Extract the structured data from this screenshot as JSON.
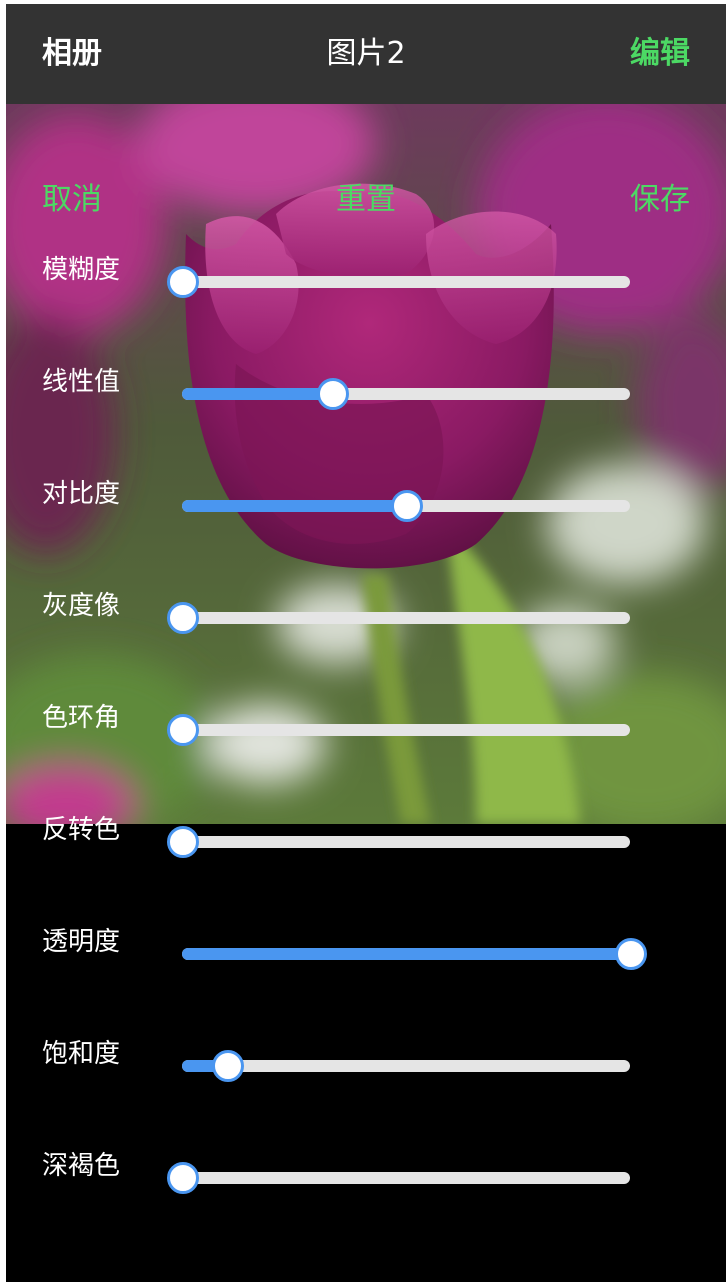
{
  "navbar": {
    "back_label": "相册",
    "title": "图片2",
    "edit_label": "编辑"
  },
  "photo": {
    "subject": "purple tulips"
  },
  "actions": {
    "cancel_label": "取消",
    "reset_label": "重置",
    "save_label": "保存"
  },
  "colors": {
    "accent_green": "#4cd964",
    "slider_blue": "#4a96f0",
    "track_gray": "#e5e5e5",
    "navbar_bg": "#333333"
  },
  "sliders": [
    {
      "label": "模糊度",
      "value": 0.0
    },
    {
      "label": "线性值",
      "value": 0.335
    },
    {
      "label": "对比度",
      "value": 0.5
    },
    {
      "label": "灰度像",
      "value": 0.0
    },
    {
      "label": "色环角",
      "value": 0.0
    },
    {
      "label": "反转色",
      "value": 0.0
    },
    {
      "label": "透明度",
      "value": 1.0
    },
    {
      "label": "饱和度",
      "value": 0.1
    },
    {
      "label": "深褐色",
      "value": 0.0
    }
  ]
}
